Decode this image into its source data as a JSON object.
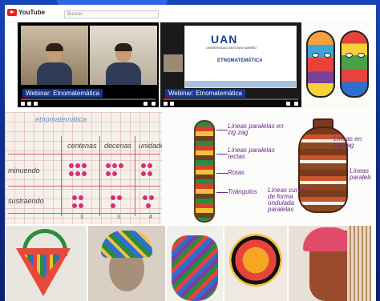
{
  "browser": {
    "app_name": "YouTube",
    "search_placeholder": "Buscar"
  },
  "videos": [
    {
      "title": "Webinar: Etnomatemática"
    },
    {
      "title": "Webinar: Etnomatemática"
    }
  ],
  "slide": {
    "logo": "UAN",
    "subtitle": "UNIVERSIDAD ANTONIO NARIÑO",
    "title": "ETNOMATEMÁTICA"
  },
  "table_drawing": {
    "title": "etnomatemática",
    "headers": [
      "centenas",
      "decenas",
      "unidades"
    ],
    "rows": [
      "minuendo",
      "sustraendo"
    ],
    "small_labels": [
      "3",
      "3",
      "4"
    ]
  },
  "ethno_drawing": {
    "annotations": [
      "Líneas paralelas en zig zag",
      "Líneas paralelas rectas",
      "Rotas",
      "Triángulos",
      "Líneas en zig zag",
      "Líneas paralelas",
      "Líneas curvas de forma ondulada paralelas"
    ]
  },
  "colors": {
    "accent": "#e62117",
    "webinar_title_bg": "#1d4fc0",
    "background": "#0f2f8f"
  }
}
